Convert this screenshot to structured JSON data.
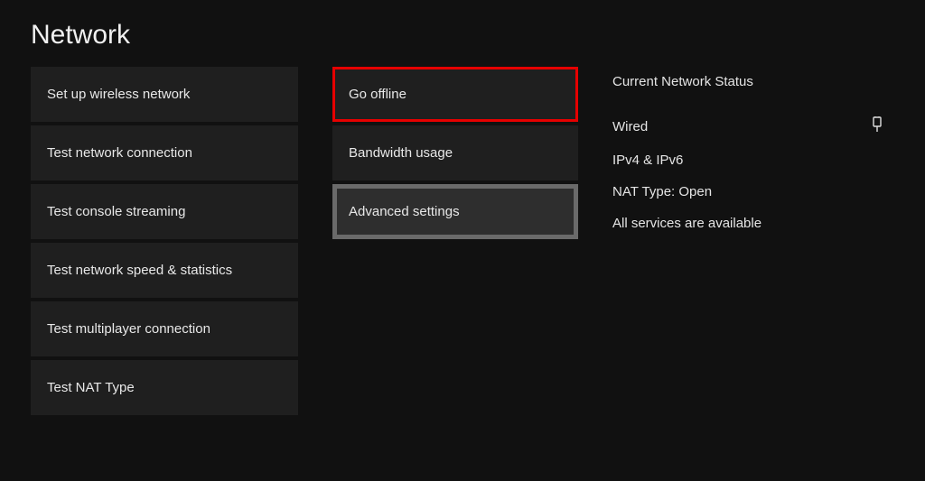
{
  "title": "Network",
  "col1": {
    "setup_wireless": "Set up wireless network",
    "test_connection": "Test network connection",
    "test_streaming": "Test console streaming",
    "test_speed": "Test network speed & statistics",
    "test_multiplayer": "Test multiplayer connection",
    "test_nat": "Test NAT Type"
  },
  "col2": {
    "go_offline": "Go offline",
    "bandwidth": "Bandwidth usage",
    "advanced": "Advanced settings"
  },
  "status": {
    "heading": "Current Network Status",
    "connection": "Wired",
    "ip": "IPv4 & IPv6",
    "nat": "NAT Type: Open",
    "services": "All services are available"
  }
}
